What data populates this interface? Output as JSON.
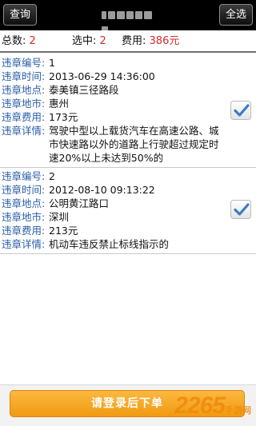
{
  "toolbar": {
    "query_label": "查询",
    "select_all_label": "全选"
  },
  "summary": {
    "total_label": "总数:",
    "total_value": "2",
    "selected_label": "选中:",
    "selected_value": "2",
    "fee_label": "费用:",
    "fee_value": "386元"
  },
  "labels": {
    "number": "违章编号:",
    "time": "违章时间:",
    "location": "违章地点:",
    "city": "违章地市:",
    "fee": "违章费用:",
    "details": "违章详情:"
  },
  "records": [
    {
      "number": "1",
      "time": "2013-06-29 14:36:00",
      "location": "泰美镇三径路段",
      "city": "惠州",
      "fee": "173元",
      "details": "驾驶中型以上载货汽车在高速公路、城市快速路以外的道路上行驶超过规定时速20%以上未达到50%的",
      "checked": true
    },
    {
      "number": "2",
      "time": "2012-08-10 09:13:22",
      "location": "公明黄江路口",
      "city": "深圳",
      "fee": "213元",
      "details": "机动车违反禁止标线指示的",
      "checked": true
    }
  ],
  "footer": {
    "login_button_label": "请登录后下单",
    "watermark_number": "2265",
    "watermark_text": "手游网"
  },
  "colors": {
    "accent_orange": "#f5a623",
    "label_blue": "#2a5ea8",
    "value_red": "#d42c2c",
    "check_blue": "#3a7cc4"
  },
  "icons": {
    "record_checkbox": "checkmark-icon"
  }
}
